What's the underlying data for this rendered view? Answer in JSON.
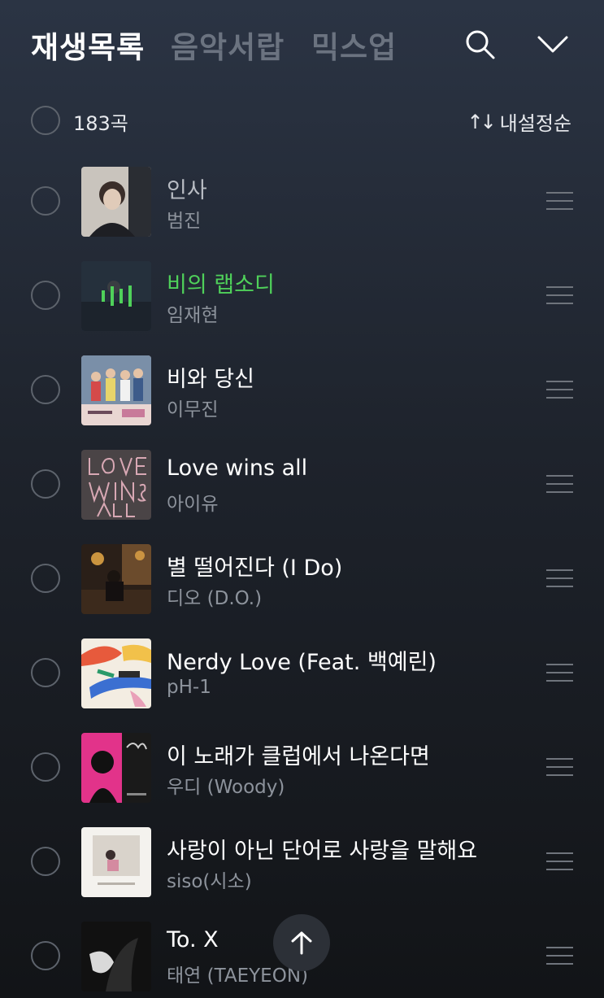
{
  "header": {
    "tabs": [
      {
        "label": "재생목록",
        "active": true
      },
      {
        "label": "음악서랍",
        "active": false
      },
      {
        "label": "믹스업",
        "active": false
      }
    ],
    "search_icon": "search-icon",
    "collapse_icon": "chevron-down-icon"
  },
  "subbar": {
    "count": "183곡",
    "sort_icon": "↑↓",
    "sort_label": "내설정순"
  },
  "colors": {
    "accent": "#4fd15a",
    "background_top": "#2b3444",
    "background_bottom": "#121417"
  },
  "tracks": [
    {
      "title": "인사",
      "artist": "범진",
      "state": "muted"
    },
    {
      "title": "비의 랩소디",
      "artist": "임재현",
      "state": "playing"
    },
    {
      "title": "비와 당신",
      "artist": "이무진",
      "state": "normal"
    },
    {
      "title": "Love wins all",
      "artist": "아이유",
      "state": "normal"
    },
    {
      "title": "별 떨어진다 (I Do)",
      "artist": "디오 (D.O.)",
      "state": "normal"
    },
    {
      "title": "Nerdy Love (Feat. 백예린)",
      "artist": "pH-1",
      "state": "normal"
    },
    {
      "title": "이 노래가 클럽에서 나온다면",
      "artist": "우디 (Woody)",
      "state": "normal"
    },
    {
      "title": "사랑이 아닌 단어로 사랑을 말해요",
      "artist": "siso(시소)",
      "state": "normal"
    },
    {
      "title": "To. X",
      "artist": "태연 (TAEYEON)",
      "state": "normal"
    }
  ],
  "scroll_top_icon": "arrow-up-icon"
}
